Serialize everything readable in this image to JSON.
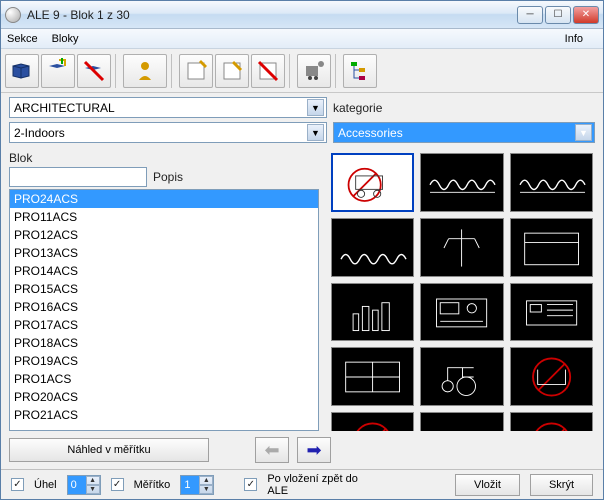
{
  "title": "ALE 9 - Blok 1 z 30",
  "menu": {
    "sekce": "Sekce",
    "bloky": "Bloky",
    "info": "Info"
  },
  "selectors": {
    "architectural": "ARCHITECTURAL",
    "indoors": "2-Indoors",
    "kategorie_label": "kategorie",
    "accessories": "Accessories"
  },
  "blok": {
    "label": "Blok",
    "popis_label": "Popis",
    "input_value": "",
    "items": [
      "PRO24ACS",
      "PRO11ACS",
      "PRO12ACS",
      "PRO13ACS",
      "PRO14ACS",
      "PRO15ACS",
      "PRO16ACS",
      "PRO17ACS",
      "PRO18ACS",
      "PRO19ACS",
      "PRO1ACS",
      "PRO20ACS",
      "PRO21ACS"
    ],
    "selected_index": 0
  },
  "nav": {
    "nahled": "Náhled v měřítku"
  },
  "bottom": {
    "uhel_label": "Úhel",
    "uhel_value": "0",
    "meritko_label": "Měřítko",
    "meritko_value": "1",
    "po_vlozeni": "Po vložení zpět do ALE",
    "vlozit": "Vložit",
    "skryt": "Skrýt"
  },
  "thumbs": {
    "selected_index": 0,
    "count": 15
  }
}
